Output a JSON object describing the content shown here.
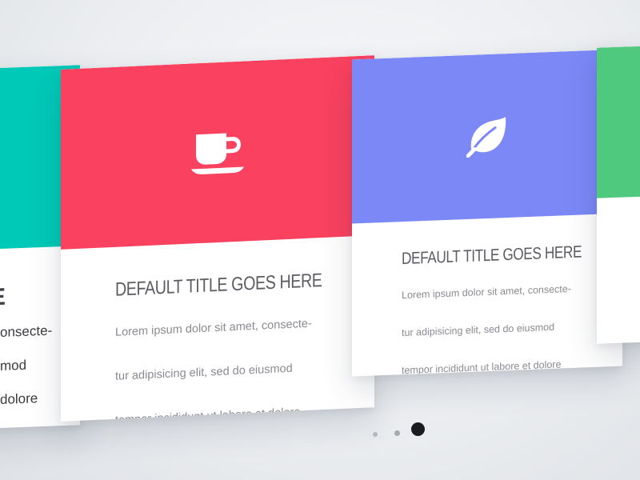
{
  "colors": {
    "card1_hero": "#00c9b7",
    "card2_hero": "#fa4160",
    "card3_hero": "#7b88f6",
    "card4_hero": "#4fc97e"
  },
  "cards": [
    {
      "title": "E",
      "lines": [
        "onsecte-",
        "mod",
        "dolore"
      ],
      "icon": null
    },
    {
      "title": "DEFAULT TITLE GOES HERE",
      "lines": [
        "Lorem ipsum dolor sit amet, consecte-",
        "tur adipisicing elit, sed do eiusmod",
        "tempor incididunt ut labore et dolore"
      ],
      "icon": "coffee-cup-icon"
    },
    {
      "title": "DEFAULT TITLE GOES HERE",
      "lines": [
        "Lorem ipsum dolor sit amet, consecte-",
        "tur adipisicing elit, sed do eiusmod",
        "tempor incididunt ut labore et dolore"
      ],
      "icon": "leaf-icon"
    },
    {
      "title": "",
      "lines": [],
      "icon": null
    }
  ],
  "pagination": {
    "total": 3,
    "active_index": 2
  }
}
